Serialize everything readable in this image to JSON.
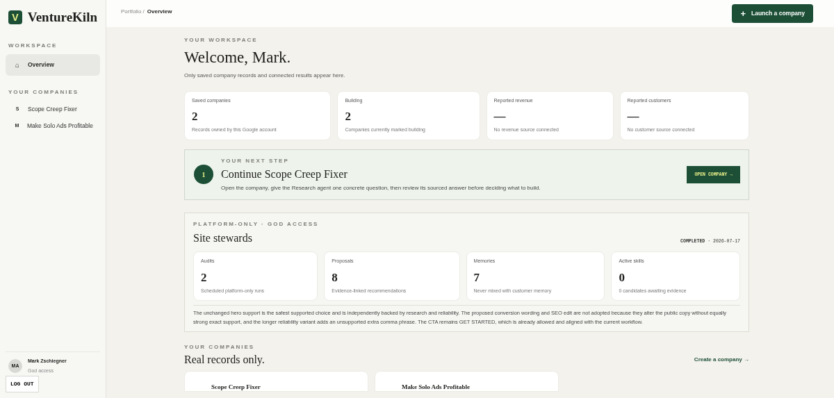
{
  "brand": {
    "letter": "V",
    "name": "VentureKiln"
  },
  "sidebar": {
    "sections": [
      {
        "heading": "WORKSPACE",
        "items": [
          {
            "kind": "nav",
            "icon_text": "⌂",
            "label": "Overview",
            "selected": true
          }
        ]
      },
      {
        "heading": "YOUR COMPANIES",
        "items": [
          {
            "kind": "company",
            "icon_text": "S",
            "label": "Scope Creep Fixer",
            "selected": false
          },
          {
            "kind": "company",
            "icon_text": "M",
            "label": "Make Solo Ads Profitable",
            "selected": false
          }
        ]
      }
    ],
    "user": {
      "initials": "MA",
      "name": "Mark Zschiegner",
      "role": "God access"
    },
    "logout": "LOG OUT"
  },
  "breadcrumb": [
    {
      "label": "Portfolio /",
      "current": false
    },
    {
      "label": "Overview",
      "current": true
    }
  ],
  "launch_button": {
    "icon": "+",
    "label": "Launch a company"
  },
  "eyebrow": "YOUR WORKSPACE",
  "title": "Welcome, Mark.",
  "subtitle": "Only saved company records and connected results appear here.",
  "stats": [
    {
      "label": "Saved companies",
      "value": "2",
      "note": "Records owned by this Google account"
    },
    {
      "label": "Building",
      "value": "2",
      "note": "Companies currently marked building"
    },
    {
      "label": "Reported revenue",
      "value": "—",
      "note": "No revenue source connected"
    },
    {
      "label": "Reported customers",
      "value": "—",
      "note": "No customer source connected"
    }
  ],
  "next_step": {
    "number": "1",
    "eyebrow": "YOUR NEXT STEP",
    "title": "Continue Scope Creep Fixer",
    "text": "Open the company, give the Research agent one concrete question, then review its sourced answer before deciding what to build.",
    "button": "OPEN COMPANY →"
  },
  "stewards": {
    "eyebrow": "PLATFORM-ONLY · GOD ACCESS",
    "title": "Site stewards",
    "status": "COMPLETED",
    "date": "· 2026-07-17",
    "stats": [
      {
        "label": "Audits",
        "value": "2",
        "note": "Scheduled platform-only runs"
      },
      {
        "label": "Proposals",
        "value": "8",
        "note": "Evidence-linked recommendations"
      },
      {
        "label": "Memories",
        "value": "7",
        "note": "Never mixed with customer memory"
      },
      {
        "label": "Active skills",
        "value": "0",
        "note": "0 candidates awaiting evidence"
      }
    ],
    "summary": "The unchanged hero support is the safest supported choice and is independently backed by research and reliability. The proposed conversion wording and SEO edit are not adopted because they alter the public copy without equally strong exact support, and the longer reliability variant adds an unsupported extra comma phrase. The CTA remains GET STARTED, which is already allowed and aligned with the current workflow."
  },
  "companies": {
    "eyebrow": "YOUR COMPANIES",
    "title": "Real records only.",
    "create_link": "Create a company →",
    "cards": [
      {
        "name": "Scope Creep Fixer"
      },
      {
        "name": "Make Solo Ads Profitable"
      }
    ]
  }
}
